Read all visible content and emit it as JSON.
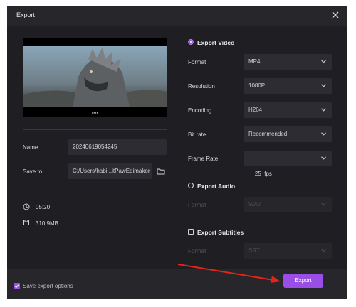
{
  "dialog": {
    "title": "Export",
    "close_icon": "close-icon"
  },
  "preview": {
    "subtitle": "LHY"
  },
  "left": {
    "name_label": "Name",
    "name_value": "20240619054245",
    "saveto_label": "Save to",
    "saveto_value": "C:/Users/habi...itPawEdimakor",
    "duration": "05:20",
    "size": "310.9MB"
  },
  "export_video": {
    "label": "Export Video",
    "selected": true,
    "format_label": "Format",
    "format_value": "MP4",
    "resolution_label": "Resolution",
    "resolution_value": "1080P",
    "encoding_label": "Encoding",
    "encoding_value": "H264",
    "bitrate_label": "Bit rate",
    "bitrate_value": "Recommended",
    "framerate_label": "Frame Rate",
    "framerate_value": "25  fps"
  },
  "export_audio": {
    "label": "Export Audio",
    "format_label": "Format",
    "format_value": "WAV"
  },
  "export_subtitles": {
    "label": "Export Subtitles",
    "format_label": "Format",
    "format_value": "SRT"
  },
  "footer": {
    "save_options_label": "Save export options",
    "export_label": "Export"
  },
  "colors": {
    "accent": "#9a4ee8",
    "background": "#1f1f23",
    "arrow": "#e0251b"
  }
}
